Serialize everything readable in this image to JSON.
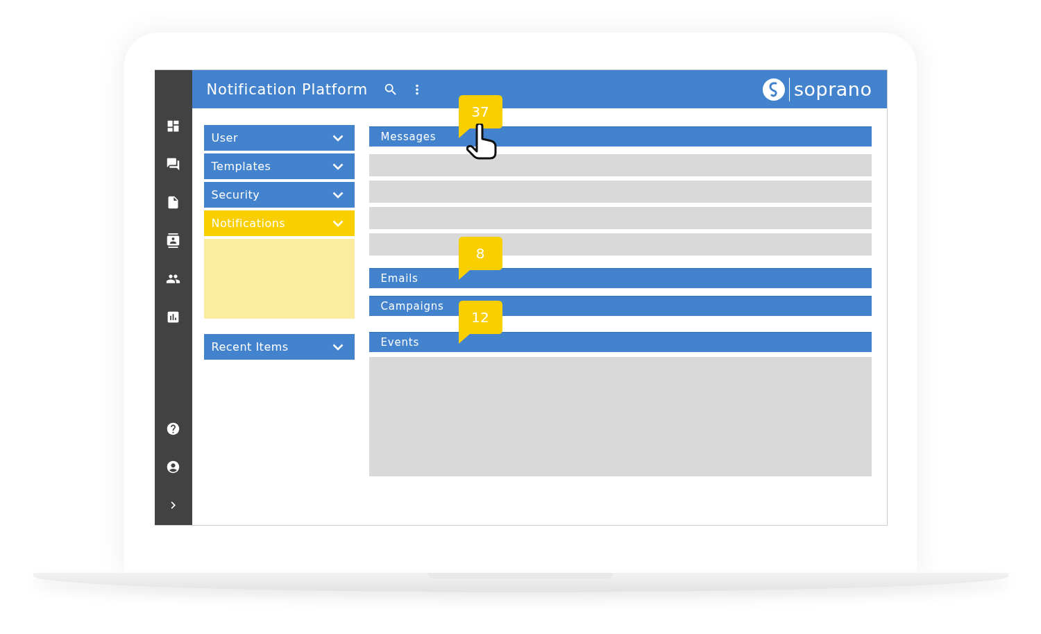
{
  "header": {
    "title": "Notification Platform",
    "logo_text": "soprano"
  },
  "menu": [
    {
      "label": "User",
      "expanded": false
    },
    {
      "label": "Templates",
      "expanded": false
    },
    {
      "label": "Security",
      "expanded": false
    },
    {
      "label": "Notifications",
      "expanded": true
    }
  ],
  "recent": {
    "label": "Recent Items",
    "expanded": false
  },
  "sections": [
    {
      "kind": "bar",
      "label": "Messages",
      "badge": "37",
      "pointer": true
    },
    {
      "kind": "row"
    },
    {
      "kind": "row"
    },
    {
      "kind": "row"
    },
    {
      "kind": "row"
    },
    {
      "kind": "gap"
    },
    {
      "kind": "bar",
      "label": "Emails",
      "badge": "8"
    },
    {
      "kind": "bar",
      "label": "Campaigns"
    },
    {
      "kind": "gap"
    },
    {
      "kind": "bar",
      "label": "Events",
      "badge": "12"
    },
    {
      "kind": "panel"
    }
  ]
}
